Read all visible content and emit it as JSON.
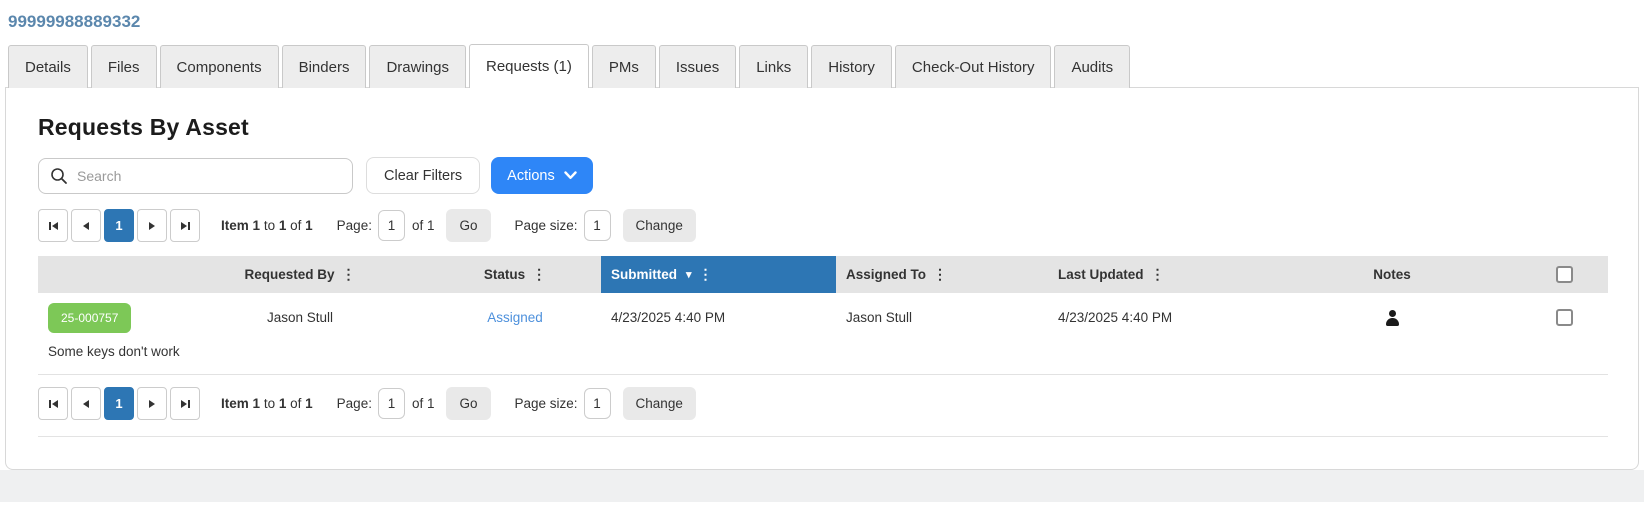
{
  "header": {
    "asset_number": "99999988889332"
  },
  "tabs": [
    {
      "label": "Details"
    },
    {
      "label": "Files"
    },
    {
      "label": "Components"
    },
    {
      "label": "Binders"
    },
    {
      "label": "Drawings"
    },
    {
      "label": "Requests (1)",
      "active": true
    },
    {
      "label": "PMs"
    },
    {
      "label": "Issues"
    },
    {
      "label": "Links"
    },
    {
      "label": "History"
    },
    {
      "label": "Check-Out History"
    },
    {
      "label": "Audits"
    }
  ],
  "panel": {
    "title": "Requests By Asset",
    "search": {
      "placeholder": "Search"
    },
    "clear_filters_label": "Clear Filters",
    "actions_label": "Actions",
    "pagination": {
      "current_page": "1",
      "summary": {
        "item_word": "Item",
        "from": "1",
        "to_word": "to",
        "to": "1",
        "of_word": "of",
        "total": "1"
      },
      "page_label": "Page:",
      "page_value": "1",
      "of_label": "of 1",
      "go_label": "Go",
      "page_size_label": "Page size:",
      "page_size_value": "1",
      "change_label": "Change"
    },
    "table": {
      "headers": {
        "requested_by": "Requested By",
        "status": "Status",
        "submitted": "Submitted",
        "assigned_to": "Assigned To",
        "last_updated": "Last Updated",
        "notes": "Notes"
      },
      "sort": {
        "column": "Submitted",
        "direction": "desc"
      },
      "row": {
        "id_badge": "25-000757",
        "requested_by": "Jason Stull",
        "status": "Assigned",
        "submitted": "4/23/2025 4:40 PM",
        "assigned_to": "Jason Stull",
        "last_updated": "4/23/2025 4:40 PM",
        "notes_icon": "person",
        "description": "Some keys don't work"
      }
    }
  },
  "icons": {
    "search": "magnifier",
    "actions_chevron": "chevron-down",
    "column_menu": "vertical-ellipsis",
    "sort_indicator": "caret-down",
    "pager_first": "skip-to-first",
    "pager_prev": "previous",
    "pager_next": "next",
    "pager_last": "skip-to-last",
    "notes": "person"
  },
  "colors": {
    "accent_blue": "#2e86f7",
    "grid_blue": "#2d76b4",
    "badge_green": "#7dc857",
    "link_blue": "#4d90dc",
    "title_blue": "#5b87ad",
    "header_gray": "#e4e4e4"
  }
}
